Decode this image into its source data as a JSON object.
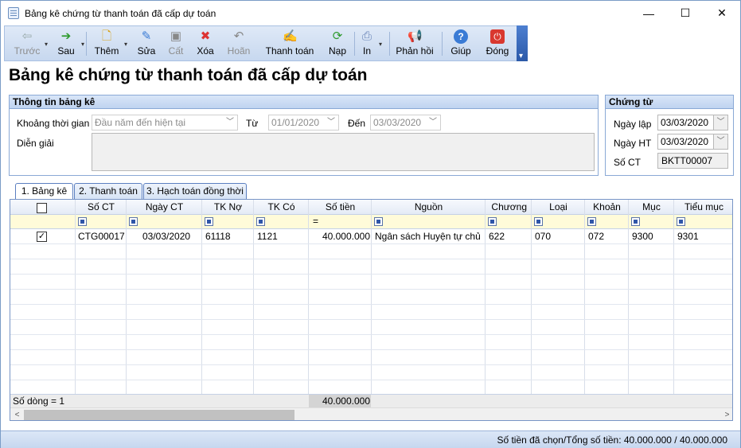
{
  "window": {
    "title": "Bảng kê chứng từ thanh toán đã cấp dự toán",
    "minimize": "—",
    "maximize": "☐",
    "close": "✕"
  },
  "toolbar": {
    "back": "Trước",
    "next": "Sau",
    "add": "Thêm",
    "edit": "Sửa",
    "save": "Cất",
    "delete": "Xóa",
    "undo": "Hoãn",
    "pay": "Thanh toán",
    "load": "Nạp",
    "print": "In",
    "feedback": "Phản hồi",
    "help": "Giúp",
    "close": "Đóng"
  },
  "page_title": "Bảng kê chứng từ thanh toán đã cấp dự toán",
  "info": {
    "header": "Thông tin bảng kê",
    "period_label": "Khoảng thời gian",
    "period_value": "Đầu năm đến hiện tại",
    "from_label": "Từ",
    "from_value": "01/01/2020",
    "to_label": "Đến",
    "to_value": "03/03/2020",
    "desc_label": "Diễn giải",
    "desc_value": ""
  },
  "voucher": {
    "header": "Chứng từ",
    "date_label": "Ngày lập",
    "date_value": "03/03/2020",
    "post_label": "Ngày HT",
    "post_value": "03/03/2020",
    "no_label": "Số CT",
    "no_value": "BKTT00007"
  },
  "tabs": [
    "1. Bảng kê",
    "2. Thanh toán",
    "3. Hạch toán đồng thời"
  ],
  "grid": {
    "columns": [
      "Số CT",
      "Ngày CT",
      "TK Nợ",
      "TK Có",
      "Số tiền",
      "Nguồn",
      "Chương",
      "Loại",
      "Khoản",
      "Mục",
      "Tiểu mục"
    ],
    "filter_eq": "=",
    "rows": [
      {
        "checked": "✓",
        "so_ct": "CTG00017",
        "ngay_ct": "03/03/2020",
        "tk_no": "61118",
        "tk_co": "1121",
        "so_tien": "40.000.000",
        "nguon": "Ngân sách Huyện tự chủ",
        "chuong": "622",
        "loai": "070",
        "khoan": "072",
        "muc": "9300",
        "tieu_muc": "9301"
      }
    ],
    "footer_count": "Số dòng = 1",
    "footer_total": "40.000.000",
    "scroll_left": "<",
    "scroll_right": ">"
  },
  "status": "Số tiền đã chọn/Tổng số tiền: 40.000.000 / 40.000.000"
}
